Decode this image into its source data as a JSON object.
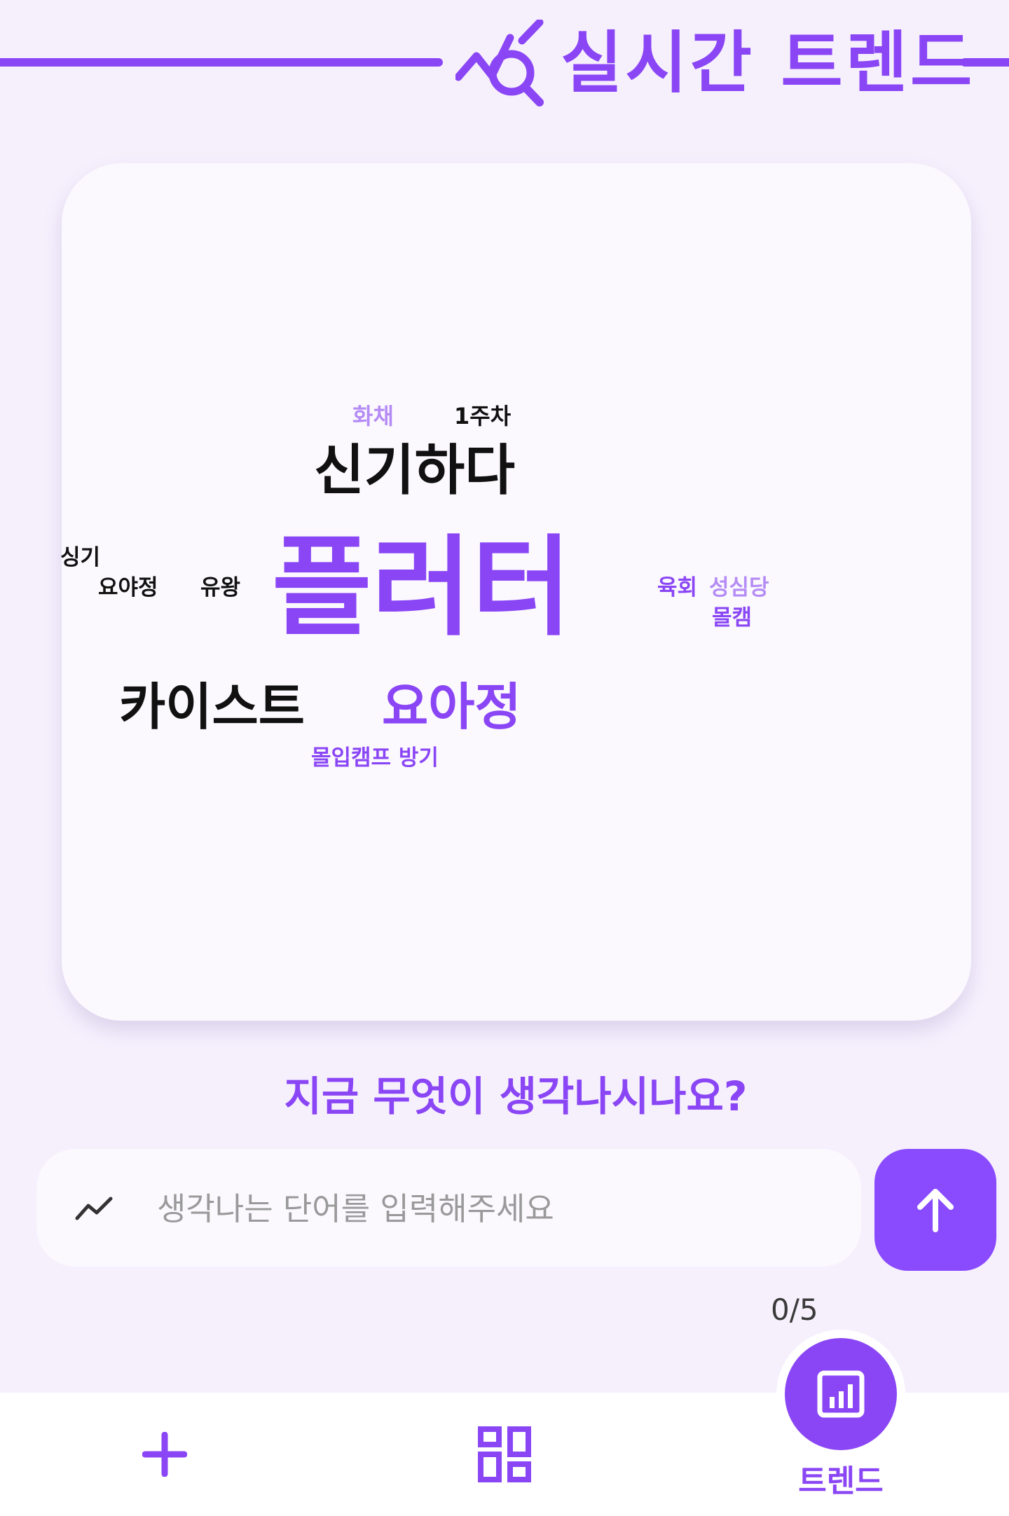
{
  "header": {
    "title": "실시간 트렌드",
    "icon": "trend-search-icon",
    "accent_color": "#8A46F5"
  },
  "word_cloud": {
    "words": [
      {
        "text": "화채",
        "color": "#B58CF5"
      },
      {
        "text": "1주차",
        "color": "#111111"
      },
      {
        "text": "신기하다",
        "color": "#111111"
      },
      {
        "text": "싱기",
        "color": "#111111"
      },
      {
        "text": "요야정",
        "color": "#111111"
      },
      {
        "text": "유왕",
        "color": "#111111"
      },
      {
        "text": "플러터",
        "color": "#8A46F5"
      },
      {
        "text": "육회",
        "color": "#8A46F5"
      },
      {
        "text": "성심당",
        "color": "#B58CF5"
      },
      {
        "text": "몰캠",
        "color": "#8A46F5"
      },
      {
        "text": "카이스트",
        "color": "#111111"
      },
      {
        "text": "요아정",
        "color": "#8A46F5"
      },
      {
        "text": "몰입캠프 방기",
        "color": "#8A46F5"
      }
    ]
  },
  "prompt": {
    "question": "지금 무엇이 생각나시나요?"
  },
  "input": {
    "icon": "trend-line-icon",
    "value": "",
    "placeholder": "생각나는 단어를 입력해주세요"
  },
  "send_button": {
    "icon": "arrow-up-icon",
    "color": "#8A4BFF"
  },
  "counter": "0/5",
  "bottom_nav": {
    "items": [
      {
        "icon": "plus-icon",
        "label": ""
      },
      {
        "icon": "boards-icon",
        "label": ""
      },
      {
        "icon": "bar-chart-icon",
        "label": "트렌드",
        "active": true
      }
    ]
  }
}
